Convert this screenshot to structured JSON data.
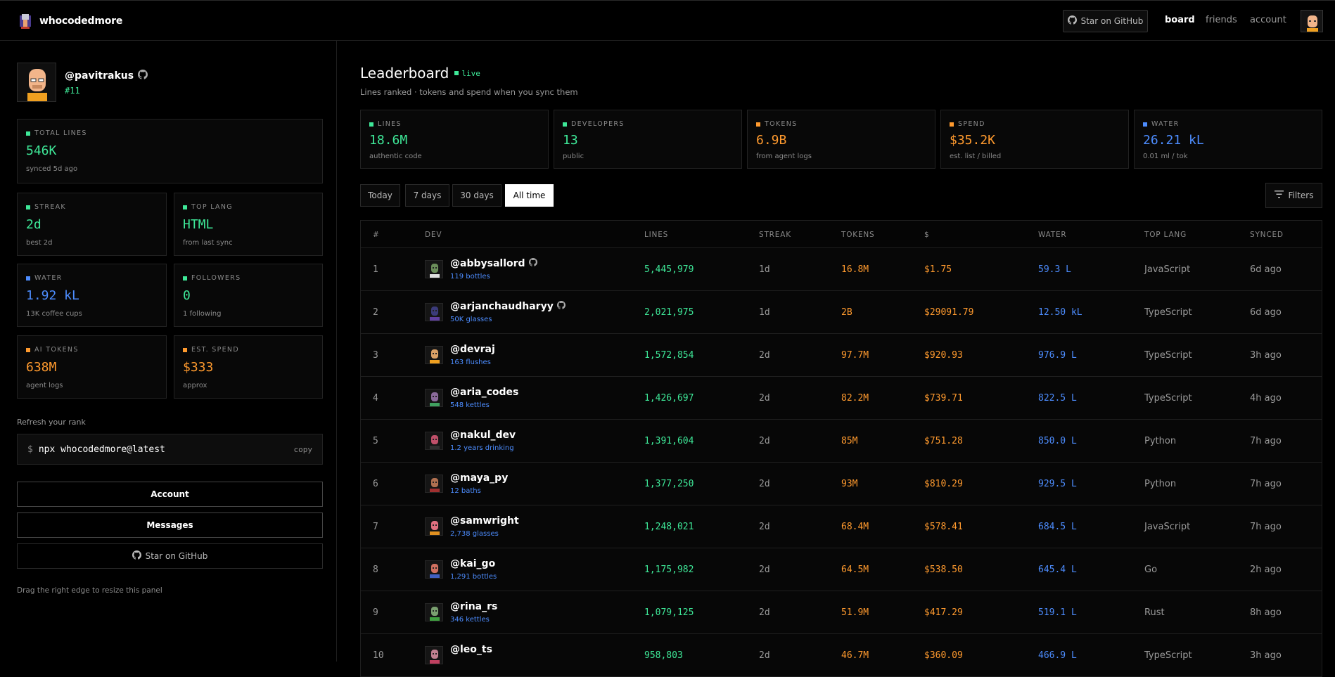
{
  "app": {
    "brand": "whocodedmore",
    "github_button": "Star on GitHub",
    "nav": [
      "board",
      "friends",
      "account"
    ]
  },
  "profile": {
    "handle": "@pavitrakus",
    "rank": "#11",
    "stats": {
      "total_lines": {
        "label": "TOTAL LINES",
        "value": "546K",
        "sub": "synced 5d ago"
      },
      "streak": {
        "label": "STREAK",
        "value": "2d",
        "sub": "best 2d"
      },
      "top_lang": {
        "label": "TOP LANG",
        "value": "HTML",
        "sub": "from last sync"
      },
      "water": {
        "label": "WATER",
        "value": "1.92 kL",
        "sub": "13K coffee cups"
      },
      "followers": {
        "label": "FOLLOWERS",
        "value": "0",
        "sub": "1 following"
      },
      "ai_tokens": {
        "label": "AI TOKENS",
        "value": "638M",
        "sub": "agent logs"
      },
      "est_spend": {
        "label": "EST. SPEND",
        "value": "$333",
        "sub": "approx"
      }
    },
    "refresh_label": "Refresh your rank",
    "command": {
      "prompt": "$",
      "text": "npx whocodedmore@latest",
      "copy": "copy"
    },
    "buttons": {
      "account": "Account",
      "messages": "Messages",
      "github": "Star on GitHub"
    },
    "drag_hint": "Drag the right edge to resize this panel"
  },
  "leaderboard": {
    "title": "Leaderboard",
    "live": "live",
    "subtitle": "Lines ranked · tokens and spend when you sync them",
    "stats": [
      {
        "label": "LINES",
        "value": "18.6M",
        "sub": "authentic code",
        "color": "#3ee898"
      },
      {
        "label": "DEVELOPERS",
        "value": "13",
        "sub": "public",
        "color": "#3ee898"
      },
      {
        "label": "TOKENS",
        "value": "6.9B",
        "sub": "from agent logs",
        "color": "#ff9a2e"
      },
      {
        "label": "SPEND",
        "value": "$35.2K",
        "sub": "est. list / billed",
        "color": "#ff9a2e"
      },
      {
        "label": "WATER",
        "value": "26.21 kL",
        "sub": "0.01 ml / tok",
        "color": "#4d8dff"
      }
    ],
    "periods": [
      "Today",
      "7 days",
      "30 days",
      "All time"
    ],
    "active_period": "All time",
    "filters": "Filters",
    "columns": [
      "#",
      "DEV",
      "LINES",
      "STREAK",
      "TOKENS",
      "$",
      "WATER",
      "TOP LANG",
      "SYNCED"
    ],
    "rows": [
      {
        "rank": "1",
        "handle": "@abbysallord",
        "github": true,
        "sub": "119 bottles",
        "lines": "5,445,979",
        "streak": "1d",
        "tokens": "16.8M",
        "spend": "$1.75",
        "water": "59.3 L",
        "lang": "JavaScript",
        "synced": "6d ago"
      },
      {
        "rank": "2",
        "handle": "@arjanchaudharyy",
        "github": true,
        "sub": "50K glasses",
        "lines": "2,021,975",
        "streak": "1d",
        "tokens": "2B",
        "spend": "$29091.79",
        "water": "12.50 kL",
        "lang": "TypeScript",
        "synced": "6d ago"
      },
      {
        "rank": "3",
        "handle": "@devraj",
        "github": false,
        "sub": "163 flushes",
        "lines": "1,572,854",
        "streak": "2d",
        "tokens": "97.7M",
        "spend": "$920.93",
        "water": "976.9 L",
        "lang": "TypeScript",
        "synced": "3h ago"
      },
      {
        "rank": "4",
        "handle": "@aria_codes",
        "github": false,
        "sub": "548 kettles",
        "lines": "1,426,697",
        "streak": "2d",
        "tokens": "82.2M",
        "spend": "$739.71",
        "water": "822.5 L",
        "lang": "TypeScript",
        "synced": "4h ago"
      },
      {
        "rank": "5",
        "handle": "@nakul_dev",
        "github": false,
        "sub": "1.2 years drinking",
        "lines": "1,391,604",
        "streak": "2d",
        "tokens": "85M",
        "spend": "$751.28",
        "water": "850.0 L",
        "lang": "Python",
        "synced": "7h ago"
      },
      {
        "rank": "6",
        "handle": "@maya_py",
        "github": false,
        "sub": "12 baths",
        "lines": "1,377,250",
        "streak": "2d",
        "tokens": "93M",
        "spend": "$810.29",
        "water": "929.5 L",
        "lang": "Python",
        "synced": "7h ago"
      },
      {
        "rank": "7",
        "handle": "@samwright",
        "github": false,
        "sub": "2,738 glasses",
        "lines": "1,248,021",
        "streak": "2d",
        "tokens": "68.4M",
        "spend": "$578.41",
        "water": "684.5 L",
        "lang": "JavaScript",
        "synced": "7h ago"
      },
      {
        "rank": "8",
        "handle": "@kai_go",
        "github": false,
        "sub": "1,291 bottles",
        "lines": "1,175,982",
        "streak": "2d",
        "tokens": "64.5M",
        "spend": "$538.50",
        "water": "645.4 L",
        "lang": "Go",
        "synced": "2h ago"
      },
      {
        "rank": "9",
        "handle": "@rina_rs",
        "github": false,
        "sub": "346 kettles",
        "lines": "1,079,125",
        "streak": "2d",
        "tokens": "51.9M",
        "spend": "$417.29",
        "water": "519.1 L",
        "lang": "Rust",
        "synced": "8h ago"
      },
      {
        "rank": "10",
        "handle": "@leo_ts",
        "github": false,
        "sub": "",
        "lines": "958,803",
        "streak": "2d",
        "tokens": "46.7M",
        "spend": "$360.09",
        "water": "466.9 L",
        "lang": "TypeScript",
        "synced": "3h ago"
      }
    ]
  }
}
